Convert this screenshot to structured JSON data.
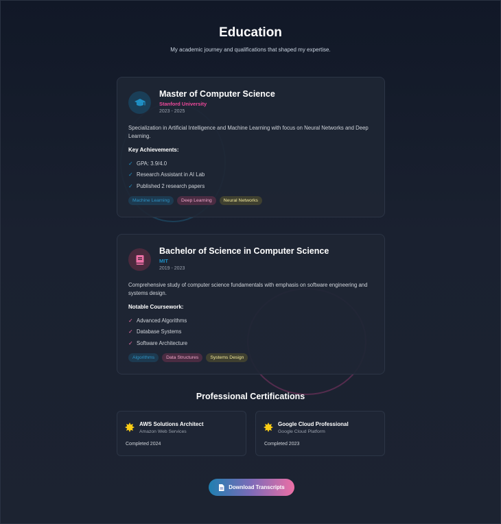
{
  "header": {
    "title": "Education",
    "subtitle": "My academic journey and qualifications that shaped my expertise."
  },
  "education": [
    {
      "degree": "Master of Computer Science",
      "school": "Stanford University",
      "years": "2023 - 2025",
      "description": "Specialization in Artificial Intelligence and Machine Learning with focus on Neural Networks and Deep Learning.",
      "list_title": "Key Achievements:",
      "items": [
        "GPA: 3.9/4.0",
        "Research Assistant in AI Lab",
        "Published 2 research papers"
      ],
      "tags": [
        "Machine Learning",
        "Deep Learning",
        "Neural Networks"
      ],
      "icon": "graduation-cap-icon",
      "accent": "#ec4899"
    },
    {
      "degree": "Bachelor of Science in Computer Science",
      "school": "MIT",
      "years": "2019 - 2023",
      "description": "Comprehensive study of computer science fundamentals with emphasis on software engineering and systems design.",
      "list_title": "Notable Coursework:",
      "items": [
        "Advanced Algorithms",
        "Database Systems",
        "Software Architecture"
      ],
      "tags": [
        "Algorithms",
        "Data Structures",
        "Systems Design"
      ],
      "icon": "book-icon",
      "accent": "#1f8fc4"
    }
  ],
  "certifications": {
    "title": "Professional Certifications",
    "items": [
      {
        "name": "AWS Solutions Architect",
        "org": "Amazon Web Services",
        "completed": "Completed 2024",
        "icon": "badge-star-icon"
      },
      {
        "name": "Google Cloud Professional",
        "org": "Google Cloud Platform",
        "completed": "Completed 2023",
        "icon": "badge-star-icon"
      }
    ]
  },
  "download_button": {
    "label": "Download Transcripts",
    "icon": "file-download-icon"
  },
  "colors": {
    "background": "#111827",
    "card": "#1e2634",
    "pink": "#ec4899",
    "blue": "#1f8fc4",
    "yellow": "#f3e99a",
    "badge_yellow": "#facc15"
  }
}
